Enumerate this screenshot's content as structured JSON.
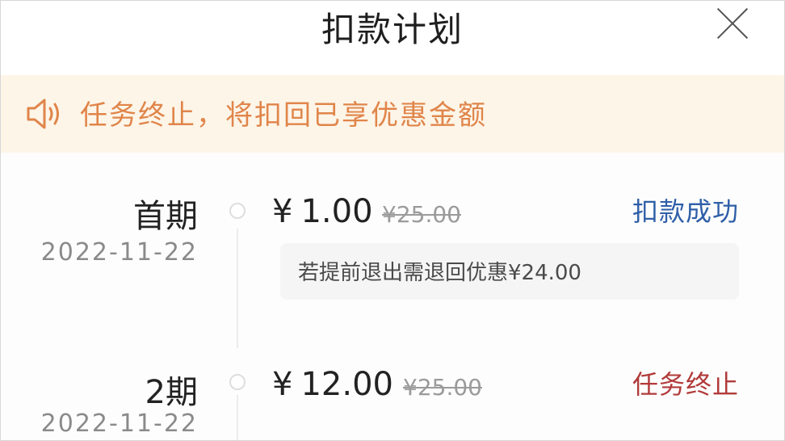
{
  "header": {
    "title": "扣款计划",
    "close_icon": "close-icon"
  },
  "notice": {
    "icon": "speaker-icon",
    "text": "任务终止，将扣回已享优惠金额",
    "color": "#e0854a"
  },
  "plan": [
    {
      "period": "首期",
      "date": "2022-11-22",
      "currency": "¥",
      "amount": "1.00",
      "original": "¥25.00",
      "status": "扣款成功",
      "status_color": "#2f5fa8",
      "tip": "若提前退出需退回优惠¥24.00"
    },
    {
      "period": "2期",
      "date": "2022-11-22",
      "currency": "¥",
      "amount": "12.00",
      "original": "¥25.00",
      "status": "任务终止",
      "status_color": "#b23a3a"
    }
  ]
}
